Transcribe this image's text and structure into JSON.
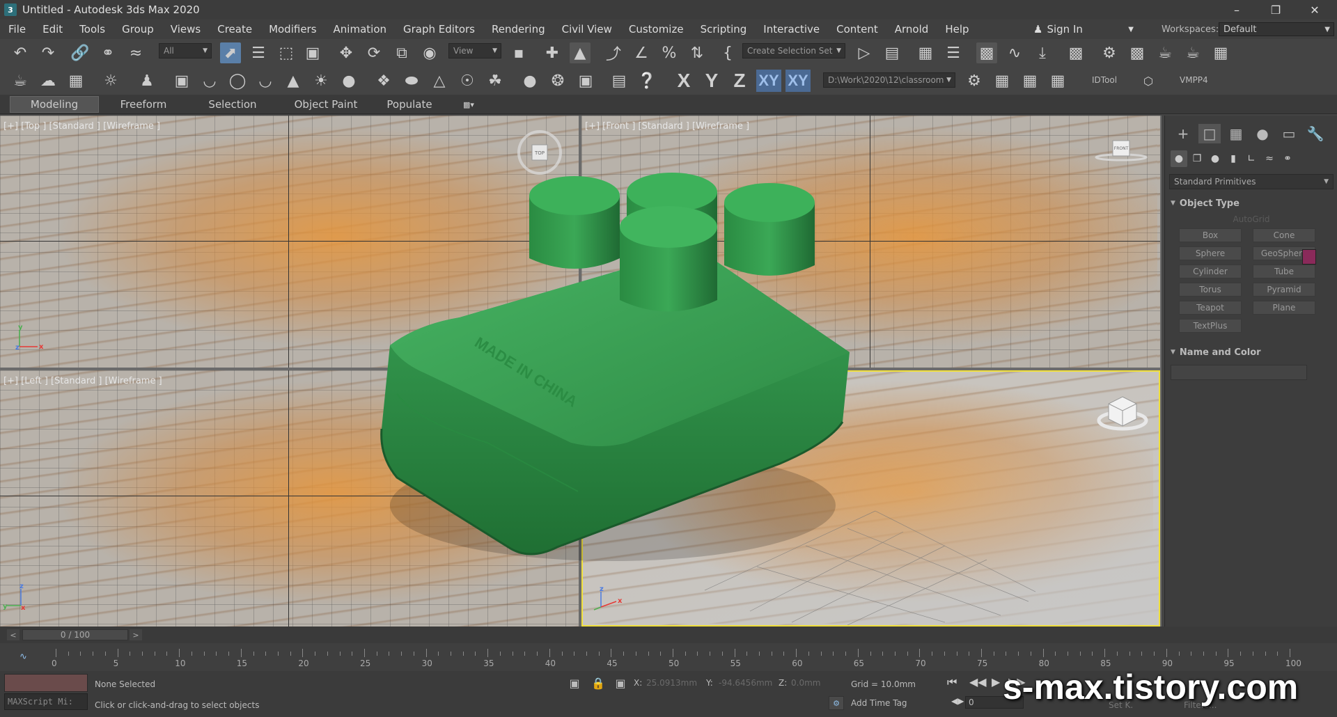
{
  "window": {
    "title": "Untitled - Autodesk 3ds Max 2020",
    "icon_letter": "3",
    "controls": [
      "minimize-icon",
      "restore-icon",
      "close-icon"
    ]
  },
  "menu": [
    "File",
    "Edit",
    "Tools",
    "Group",
    "Views",
    "Create",
    "Modifiers",
    "Animation",
    "Graph Editors",
    "Rendering",
    "Civil View",
    "Customize",
    "Scripting",
    "Interactive",
    "Content",
    "Arnold",
    "Help"
  ],
  "account": {
    "sign_in": "Sign In",
    "workspaces_label": "Workspaces:",
    "workspace": "Default"
  },
  "toolbar": {
    "selection_filter": "All",
    "reference_coord": "View",
    "selection_set": "Create Selection Set",
    "project_path": "D:\\Work\\2020\\12\\classroom",
    "axis_constraints": [
      "X",
      "Y",
      "Z",
      "XY",
      "XY"
    ],
    "idtool": "IDTool",
    "vmpp": "VMPP4"
  },
  "ribbon_tabs": [
    "Modeling",
    "Freeform",
    "Selection",
    "Object Paint",
    "Populate"
  ],
  "viewports": {
    "top": "[+] [Top ] [Standard ] [Wireframe ]",
    "front": "[+] [Front ] [Standard ] [Wireframe ]",
    "left": "[+] [Left ] [Standard ] [Wireframe ]",
    "viewcube_top": "TOP",
    "viewcube_front": "FRONT",
    "brick_text": "MADE IN CHINA"
  },
  "command_panel": {
    "category": "Standard Primitives",
    "object_type_title": "Object Type",
    "autogrid": "AutoGrid",
    "primitives": [
      "Box",
      "Cone",
      "Sphere",
      "GeoSphere",
      "Cylinder",
      "Tube",
      "Torus",
      "Pyramid",
      "Teapot",
      "Plane",
      "TextPlus"
    ],
    "name_color_title": "Name and Color",
    "object_color": "#8a2a5a"
  },
  "time_slider": {
    "position": "0 / 100",
    "prev": "<",
    "next": ">"
  },
  "trackbar_ticks": [
    "0",
    "5",
    "10",
    "15",
    "20",
    "25",
    "30",
    "35",
    "40",
    "45",
    "50",
    "55",
    "60",
    "65",
    "70",
    "75",
    "80",
    "85",
    "90",
    "95",
    "100"
  ],
  "status": {
    "maxscript": "MAXScript Mi:",
    "selection": "None Selected",
    "prompt": "Click or click-and-drag to select objects",
    "x_label": "X:",
    "x_value": "25.0913mm",
    "y_label": "Y:",
    "y_value": "-94.6456mm",
    "z_label": "Z:",
    "z_value": "0.0mm",
    "grid": "Grid = 10.0mm",
    "add_time_tag": "Add Time Tag",
    "frame": "0",
    "set_k": "Set K.",
    "filters": "Filters..."
  },
  "watermark": "s-max.tistory.com"
}
